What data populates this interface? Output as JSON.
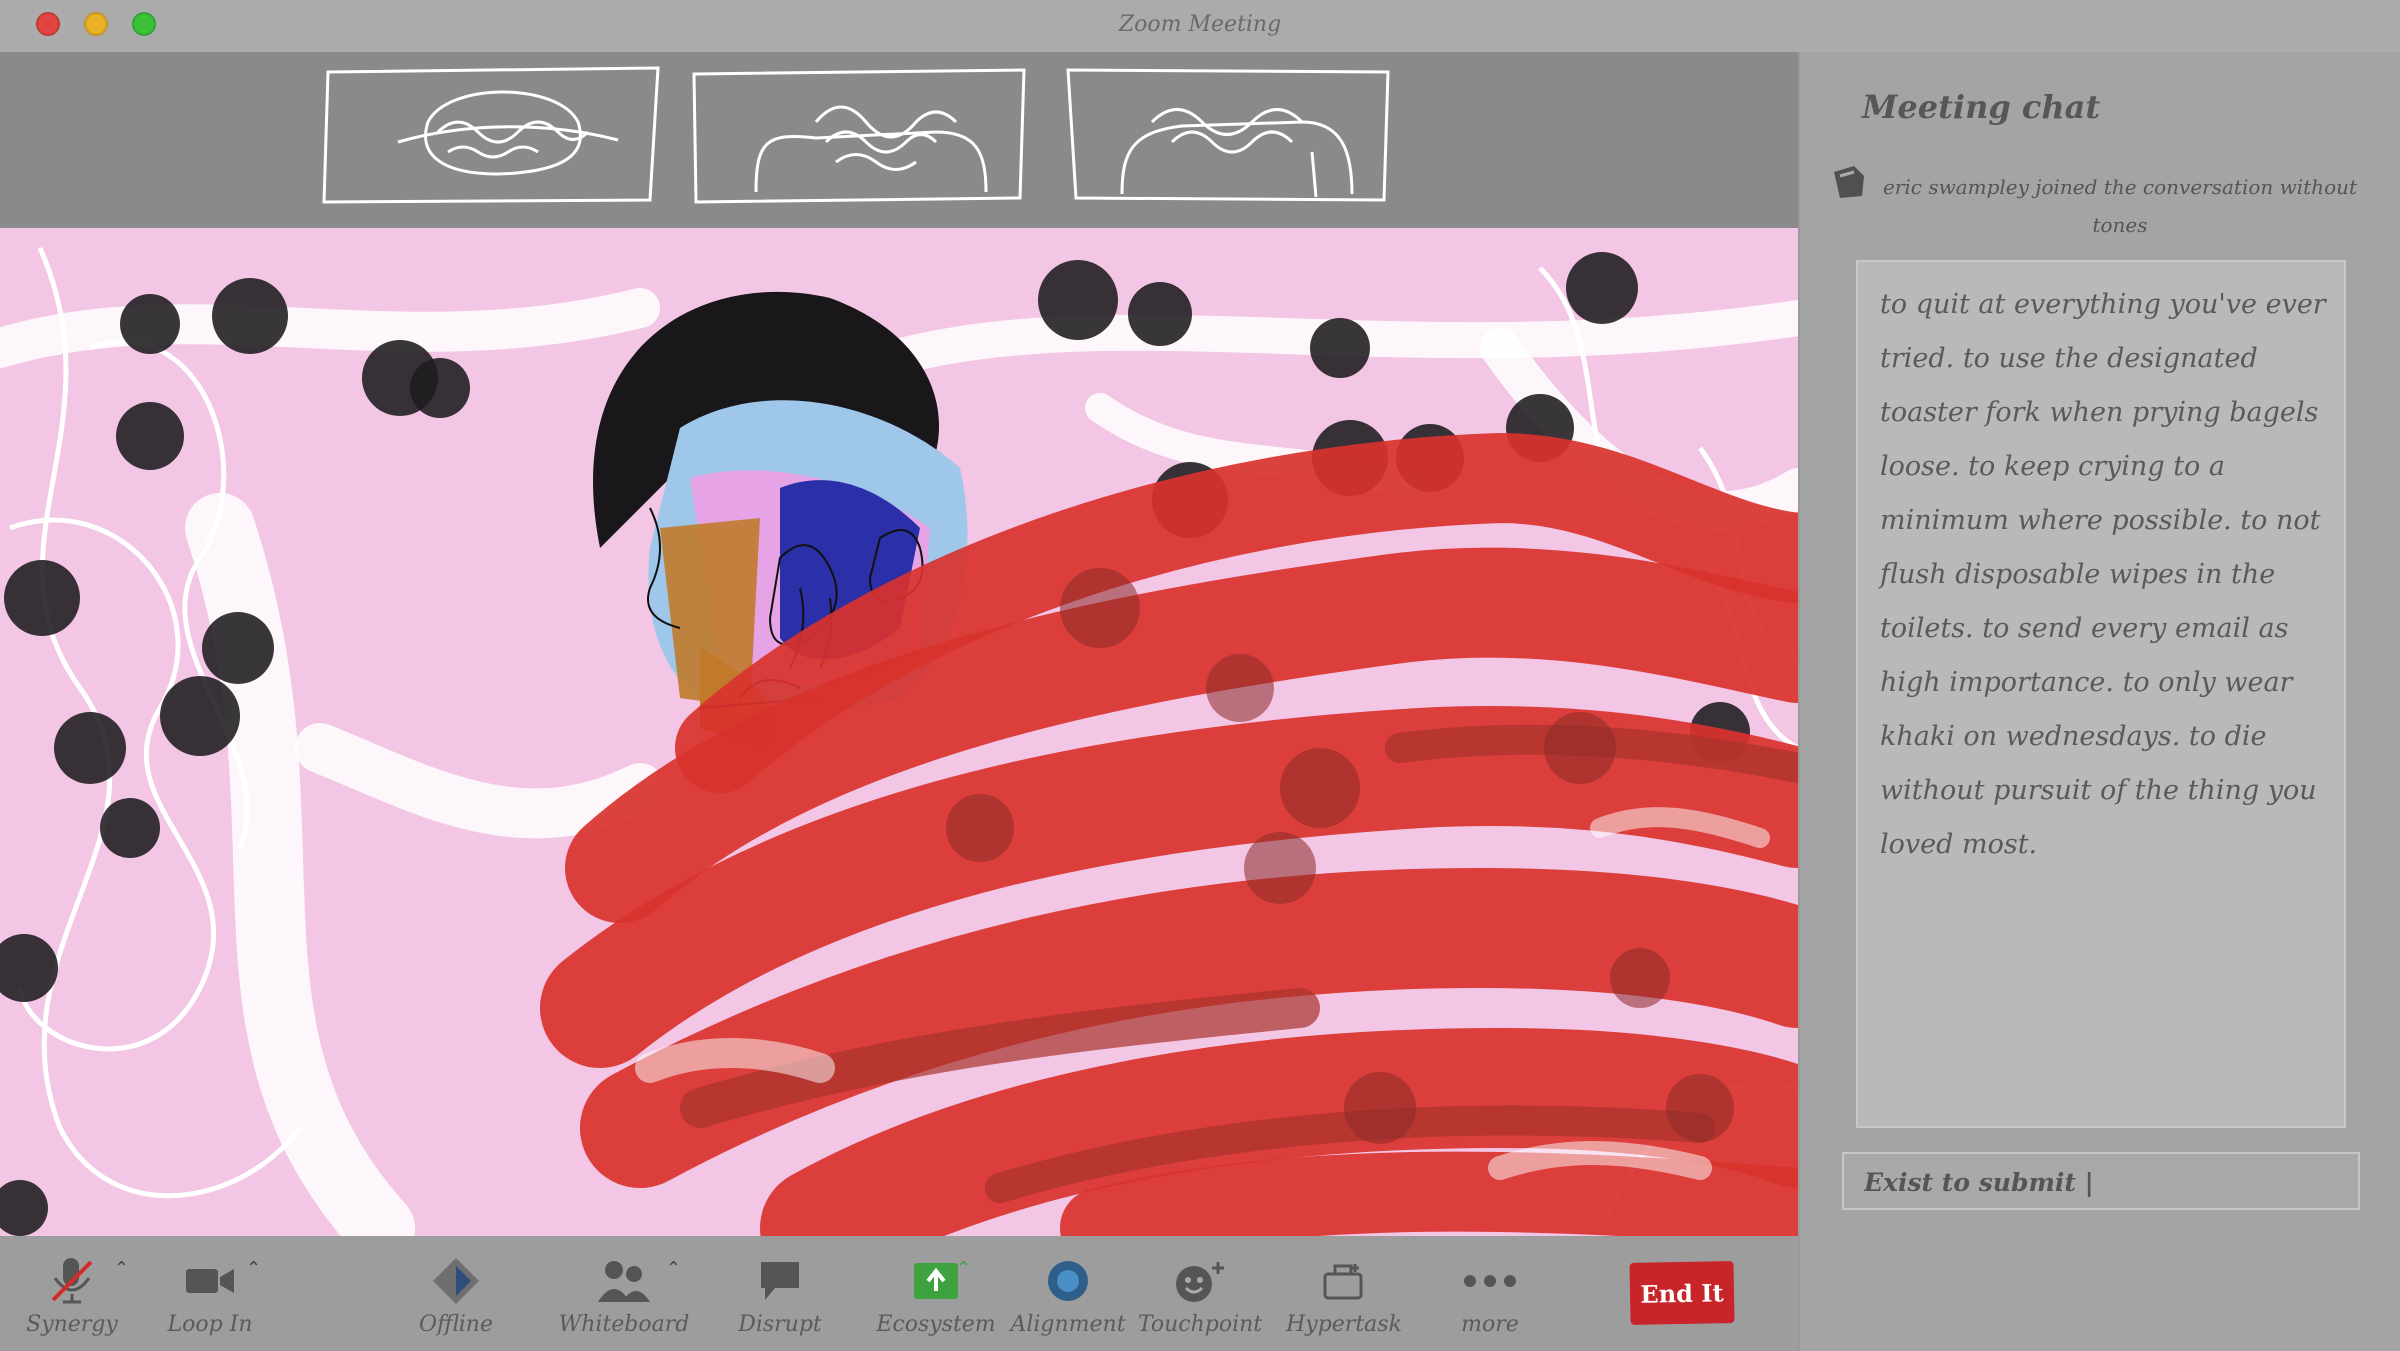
{
  "window": {
    "title": "Zoom Meeting"
  },
  "toolbar": {
    "items": [
      {
        "label": "Synergy",
        "icon": "mic-muted-icon"
      },
      {
        "label": "Loop In",
        "icon": "video-camera-icon"
      },
      {
        "label": "Offline",
        "icon": "diamond-icon"
      },
      {
        "label": "Whiteboard",
        "icon": "participants-icon"
      },
      {
        "label": "Disrupt",
        "icon": "speech-bubble-icon"
      },
      {
        "label": "Ecosystem",
        "icon": "share-screen-icon"
      },
      {
        "label": "Alignment",
        "icon": "record-icon"
      },
      {
        "label": "Touchpoint",
        "icon": "reaction-icon"
      },
      {
        "label": "Hypertask",
        "icon": "apps-icon"
      },
      {
        "label": "more",
        "icon": "more-dots-icon"
      }
    ],
    "end_label": "End It"
  },
  "chat": {
    "title": "Meeting chat",
    "system_message": "eric swampley  joined the conversation without tones",
    "message": "to quit at everything you've ever tried. to use the designated toaster fork when prying bagels loose. to keep crying to a minimum where possible. to not flush disposable wipes in the toilets. to send every email as high importance. to only wear khaki on wednesdays. to die without pursuit of the thing you loved most.",
    "input_value": "Exist to submit |"
  },
  "colors": {
    "end_button": "#c8252b",
    "stage_bg": "#f2c6e4",
    "paint_red": "#d9322c"
  }
}
